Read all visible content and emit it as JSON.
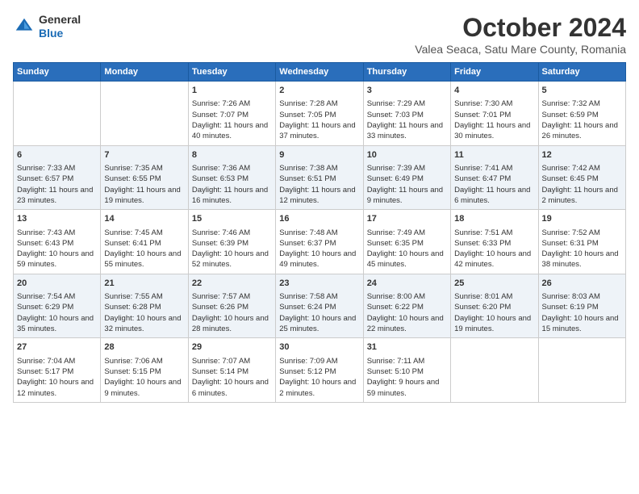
{
  "header": {
    "logo": {
      "general": "General",
      "blue": "Blue"
    },
    "title": "October 2024",
    "location": "Valea Seaca, Satu Mare County, Romania"
  },
  "calendar": {
    "days_of_week": [
      "Sunday",
      "Monday",
      "Tuesday",
      "Wednesday",
      "Thursday",
      "Friday",
      "Saturday"
    ],
    "weeks": [
      [
        {
          "day": "",
          "content": ""
        },
        {
          "day": "",
          "content": ""
        },
        {
          "day": "1",
          "sunrise": "Sunrise: 7:26 AM",
          "sunset": "Sunset: 7:07 PM",
          "daylight": "Daylight: 11 hours and 40 minutes."
        },
        {
          "day": "2",
          "sunrise": "Sunrise: 7:28 AM",
          "sunset": "Sunset: 7:05 PM",
          "daylight": "Daylight: 11 hours and 37 minutes."
        },
        {
          "day": "3",
          "sunrise": "Sunrise: 7:29 AM",
          "sunset": "Sunset: 7:03 PM",
          "daylight": "Daylight: 11 hours and 33 minutes."
        },
        {
          "day": "4",
          "sunrise": "Sunrise: 7:30 AM",
          "sunset": "Sunset: 7:01 PM",
          "daylight": "Daylight: 11 hours and 30 minutes."
        },
        {
          "day": "5",
          "sunrise": "Sunrise: 7:32 AM",
          "sunset": "Sunset: 6:59 PM",
          "daylight": "Daylight: 11 hours and 26 minutes."
        }
      ],
      [
        {
          "day": "6",
          "sunrise": "Sunrise: 7:33 AM",
          "sunset": "Sunset: 6:57 PM",
          "daylight": "Daylight: 11 hours and 23 minutes."
        },
        {
          "day": "7",
          "sunrise": "Sunrise: 7:35 AM",
          "sunset": "Sunset: 6:55 PM",
          "daylight": "Daylight: 11 hours and 19 minutes."
        },
        {
          "day": "8",
          "sunrise": "Sunrise: 7:36 AM",
          "sunset": "Sunset: 6:53 PM",
          "daylight": "Daylight: 11 hours and 16 minutes."
        },
        {
          "day": "9",
          "sunrise": "Sunrise: 7:38 AM",
          "sunset": "Sunset: 6:51 PM",
          "daylight": "Daylight: 11 hours and 12 minutes."
        },
        {
          "day": "10",
          "sunrise": "Sunrise: 7:39 AM",
          "sunset": "Sunset: 6:49 PM",
          "daylight": "Daylight: 11 hours and 9 minutes."
        },
        {
          "day": "11",
          "sunrise": "Sunrise: 7:41 AM",
          "sunset": "Sunset: 6:47 PM",
          "daylight": "Daylight: 11 hours and 6 minutes."
        },
        {
          "day": "12",
          "sunrise": "Sunrise: 7:42 AM",
          "sunset": "Sunset: 6:45 PM",
          "daylight": "Daylight: 11 hours and 2 minutes."
        }
      ],
      [
        {
          "day": "13",
          "sunrise": "Sunrise: 7:43 AM",
          "sunset": "Sunset: 6:43 PM",
          "daylight": "Daylight: 10 hours and 59 minutes."
        },
        {
          "day": "14",
          "sunrise": "Sunrise: 7:45 AM",
          "sunset": "Sunset: 6:41 PM",
          "daylight": "Daylight: 10 hours and 55 minutes."
        },
        {
          "day": "15",
          "sunrise": "Sunrise: 7:46 AM",
          "sunset": "Sunset: 6:39 PM",
          "daylight": "Daylight: 10 hours and 52 minutes."
        },
        {
          "day": "16",
          "sunrise": "Sunrise: 7:48 AM",
          "sunset": "Sunset: 6:37 PM",
          "daylight": "Daylight: 10 hours and 49 minutes."
        },
        {
          "day": "17",
          "sunrise": "Sunrise: 7:49 AM",
          "sunset": "Sunset: 6:35 PM",
          "daylight": "Daylight: 10 hours and 45 minutes."
        },
        {
          "day": "18",
          "sunrise": "Sunrise: 7:51 AM",
          "sunset": "Sunset: 6:33 PM",
          "daylight": "Daylight: 10 hours and 42 minutes."
        },
        {
          "day": "19",
          "sunrise": "Sunrise: 7:52 AM",
          "sunset": "Sunset: 6:31 PM",
          "daylight": "Daylight: 10 hours and 38 minutes."
        }
      ],
      [
        {
          "day": "20",
          "sunrise": "Sunrise: 7:54 AM",
          "sunset": "Sunset: 6:29 PM",
          "daylight": "Daylight: 10 hours and 35 minutes."
        },
        {
          "day": "21",
          "sunrise": "Sunrise: 7:55 AM",
          "sunset": "Sunset: 6:28 PM",
          "daylight": "Daylight: 10 hours and 32 minutes."
        },
        {
          "day": "22",
          "sunrise": "Sunrise: 7:57 AM",
          "sunset": "Sunset: 6:26 PM",
          "daylight": "Daylight: 10 hours and 28 minutes."
        },
        {
          "day": "23",
          "sunrise": "Sunrise: 7:58 AM",
          "sunset": "Sunset: 6:24 PM",
          "daylight": "Daylight: 10 hours and 25 minutes."
        },
        {
          "day": "24",
          "sunrise": "Sunrise: 8:00 AM",
          "sunset": "Sunset: 6:22 PM",
          "daylight": "Daylight: 10 hours and 22 minutes."
        },
        {
          "day": "25",
          "sunrise": "Sunrise: 8:01 AM",
          "sunset": "Sunset: 6:20 PM",
          "daylight": "Daylight: 10 hours and 19 minutes."
        },
        {
          "day": "26",
          "sunrise": "Sunrise: 8:03 AM",
          "sunset": "Sunset: 6:19 PM",
          "daylight": "Daylight: 10 hours and 15 minutes."
        }
      ],
      [
        {
          "day": "27",
          "sunrise": "Sunrise: 7:04 AM",
          "sunset": "Sunset: 5:17 PM",
          "daylight": "Daylight: 10 hours and 12 minutes."
        },
        {
          "day": "28",
          "sunrise": "Sunrise: 7:06 AM",
          "sunset": "Sunset: 5:15 PM",
          "daylight": "Daylight: 10 hours and 9 minutes."
        },
        {
          "day": "29",
          "sunrise": "Sunrise: 7:07 AM",
          "sunset": "Sunset: 5:14 PM",
          "daylight": "Daylight: 10 hours and 6 minutes."
        },
        {
          "day": "30",
          "sunrise": "Sunrise: 7:09 AM",
          "sunset": "Sunset: 5:12 PM",
          "daylight": "Daylight: 10 hours and 2 minutes."
        },
        {
          "day": "31",
          "sunrise": "Sunrise: 7:11 AM",
          "sunset": "Sunset: 5:10 PM",
          "daylight": "Daylight: 9 hours and 59 minutes."
        },
        {
          "day": "",
          "content": ""
        },
        {
          "day": "",
          "content": ""
        }
      ]
    ]
  }
}
